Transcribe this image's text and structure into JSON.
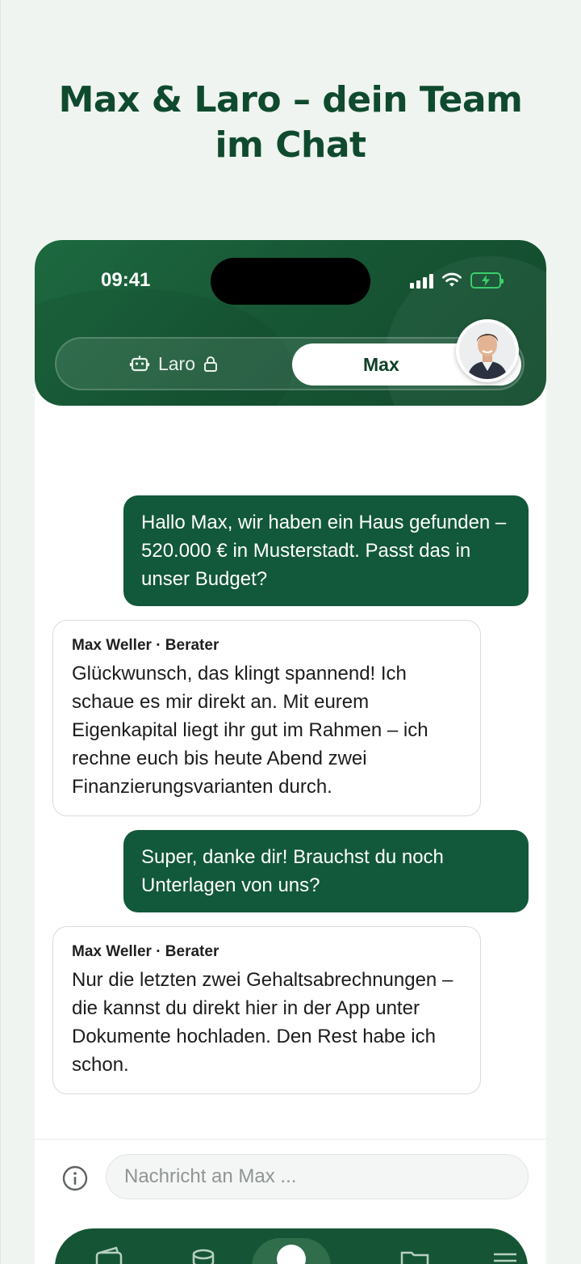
{
  "page": {
    "title": "Max & Laro – dein Team im Chat"
  },
  "status_bar": {
    "time": "09:41"
  },
  "switcher": {
    "laro_label": "Laro",
    "max_label": "Max",
    "active": "Max"
  },
  "messages": [
    {
      "from": "user",
      "text": "Hallo Max, wir haben ein Haus gefunden – 520.000 € in Musterstadt. Passt das in unser Budget?"
    },
    {
      "from": "advisor",
      "sender": "Max Weller · Berater",
      "text": "Glückwunsch, das klingt spannend! Ich schaue es mir direkt an. Mit eurem Eigenkapital liegt ihr gut im Rahmen – ich rechne euch bis heute Abend zwei Finanzierungsvarianten durch."
    },
    {
      "from": "user",
      "text": "Super, danke dir! Brauchst du noch Unterlagen von uns?"
    },
    {
      "from": "advisor",
      "sender": "Max Weller · Berater",
      "text": "Nur die letzten zwei Gehaltsabrechnungen – die kannst du direkt hier in der App unter Dokumente hochladen. Den Rest habe ich schon."
    }
  ],
  "composer": {
    "placeholder": "Nachricht an Max ..."
  },
  "icons": [
    "robot-icon",
    "lock-icon",
    "signal-icon",
    "wifi-icon",
    "battery-icon",
    "info-icon",
    "wallet-icon",
    "coins-icon",
    "chat-icon",
    "folder-icon",
    "menu-icon"
  ],
  "colors": {
    "brand_green": "#12583a",
    "title_green": "#0f4a2e",
    "page_bg": "#eff4f0",
    "battery_green": "#3ccf6c"
  }
}
